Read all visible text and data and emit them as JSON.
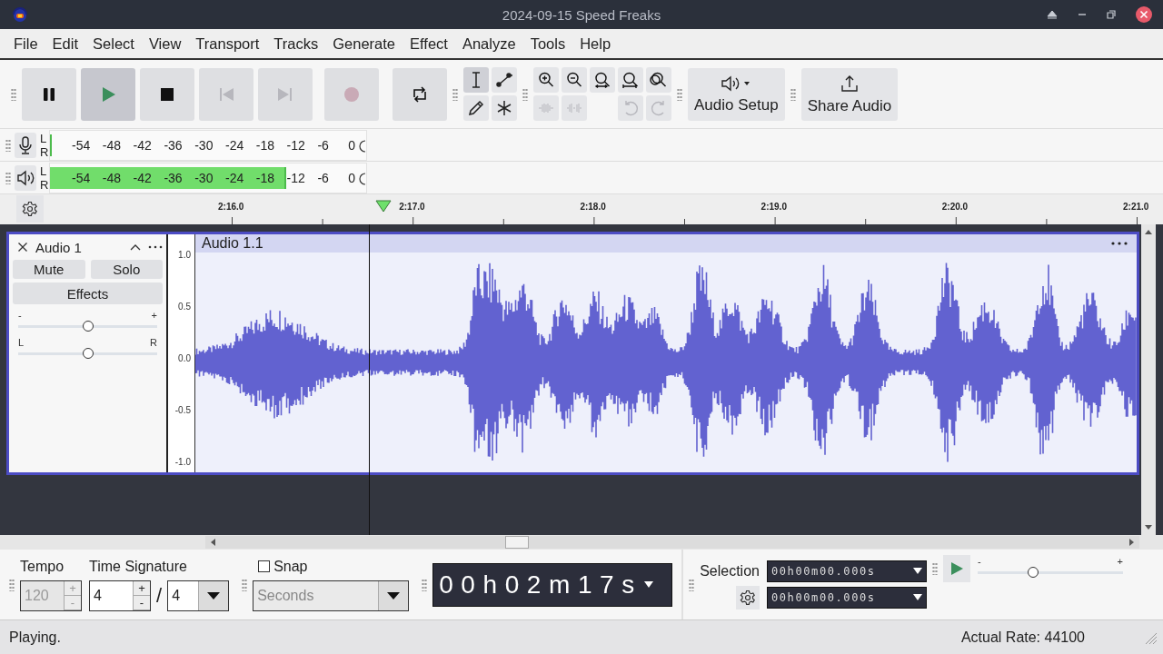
{
  "window": {
    "title": "2024-09-15 Speed Freaks"
  },
  "menu": [
    "File",
    "Edit",
    "Select",
    "View",
    "Transport",
    "Tracks",
    "Generate",
    "Effect",
    "Analyze",
    "Tools",
    "Help"
  ],
  "transport": [
    {
      "kind": "pause",
      "pressed": false,
      "disabled": false
    },
    {
      "kind": "play",
      "pressed": true,
      "disabled": false
    },
    {
      "kind": "stop",
      "pressed": false,
      "disabled": false
    },
    {
      "kind": "skip-start",
      "pressed": false,
      "disabled": true
    },
    {
      "kind": "skip-end",
      "pressed": false,
      "disabled": true
    },
    {
      "kind": "record",
      "pressed": false,
      "disabled": true
    },
    {
      "kind": "loop",
      "pressed": false,
      "disabled": false
    }
  ],
  "tools": [
    {
      "kind": "select",
      "selected": true
    },
    {
      "kind": "envelope",
      "selected": false
    },
    {
      "kind": "draw",
      "selected": false
    },
    {
      "kind": "multi",
      "selected": false
    }
  ],
  "zoom_tools": [
    {
      "kind": "zoom-in",
      "disabled": false
    },
    {
      "kind": "zoom-out",
      "disabled": false
    },
    {
      "kind": "fit-selection",
      "disabled": false
    },
    {
      "kind": "fit-project",
      "disabled": false
    },
    {
      "kind": "zoom-toggle",
      "disabled": false
    }
  ],
  "edit_tools": [
    {
      "kind": "trim",
      "disabled": true
    },
    {
      "kind": "silence",
      "disabled": true
    }
  ],
  "history": [
    {
      "kind": "undo",
      "disabled": true
    },
    {
      "kind": "redo",
      "disabled": true
    }
  ],
  "audio_setup": {
    "label": "Audio Setup"
  },
  "share": {
    "label": "Share Audio"
  },
  "meters": [
    {
      "kind": "record",
      "channels": [
        "L",
        "R"
      ],
      "ticks": [
        "-54",
        "-48",
        "-42",
        "-36",
        "-30",
        "-24",
        "-18",
        "-12",
        "-6",
        "0"
      ],
      "level": 0
    },
    {
      "kind": "playback",
      "channels": [
        "L",
        "R"
      ],
      "ticks": [
        "-54",
        "-48",
        "-42",
        "-36",
        "-30",
        "-24",
        "-18",
        "-12",
        "-6",
        "0"
      ],
      "level": 0.74
    }
  ],
  "timeline": {
    "labels": [
      "2:16.0",
      "2:17.0",
      "2:18.0",
      "2:19.0",
      "2:20.0",
      "2:21.0"
    ]
  },
  "track": {
    "name": "Audio 1",
    "mute": "Mute",
    "solo": "Solo",
    "effects": "Effects",
    "gain": {
      "min": "-",
      "max": "+",
      "level": 0.5
    },
    "pan": {
      "min": "L",
      "max": "R",
      "level": 0.5
    },
    "clip": "Audio 1.1",
    "scale": [
      "1.0",
      "0.5",
      "0.0",
      "-0.5",
      "-1.0"
    ]
  },
  "tempo": {
    "label": "Tempo",
    "value": "120",
    "disabled": true,
    "up": "+",
    "down": "-"
  },
  "time_signature": {
    "label": "Time Signature",
    "upper": "4",
    "lower": "4",
    "separator": "/",
    "up": "+",
    "down": "-"
  },
  "snap": {
    "label": "Snap",
    "checked": false,
    "unit": "Seconds"
  },
  "time": "00h02m17s",
  "selection": {
    "label": "Selection",
    "start": "00h00m00.000s",
    "end": "00h00m00.000s"
  },
  "play_speed": {
    "min": "-",
    "max": "+",
    "level": 0.38
  },
  "status": {
    "text": "Playing.",
    "rate": "Actual Rate: 44100"
  }
}
